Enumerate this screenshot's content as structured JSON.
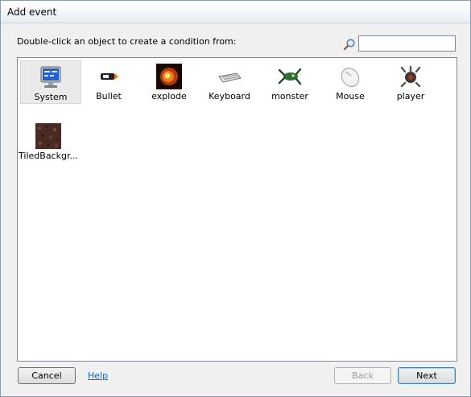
{
  "window": {
    "title": "Add event"
  },
  "instruction": "Double-click an object to create a condition from:",
  "search": {
    "placeholder": "",
    "value": ""
  },
  "objects": [
    {
      "label": "System",
      "icon": "monitor-icon"
    },
    {
      "label": "Bullet",
      "icon": "bullet-icon"
    },
    {
      "label": "explode",
      "icon": "explosion-icon"
    },
    {
      "label": "Keyboard",
      "icon": "keyboard-icon"
    },
    {
      "label": "monster",
      "icon": "monster-icon"
    },
    {
      "label": "Mouse",
      "icon": "mouse-icon"
    },
    {
      "label": "player",
      "icon": "player-icon"
    },
    {
      "label": "TiledBackgr...",
      "icon": "tiled-background-icon"
    }
  ],
  "selected_object": "System",
  "buttons": {
    "cancel": "Cancel",
    "help": "Help",
    "back": "Back",
    "next": "Next"
  }
}
